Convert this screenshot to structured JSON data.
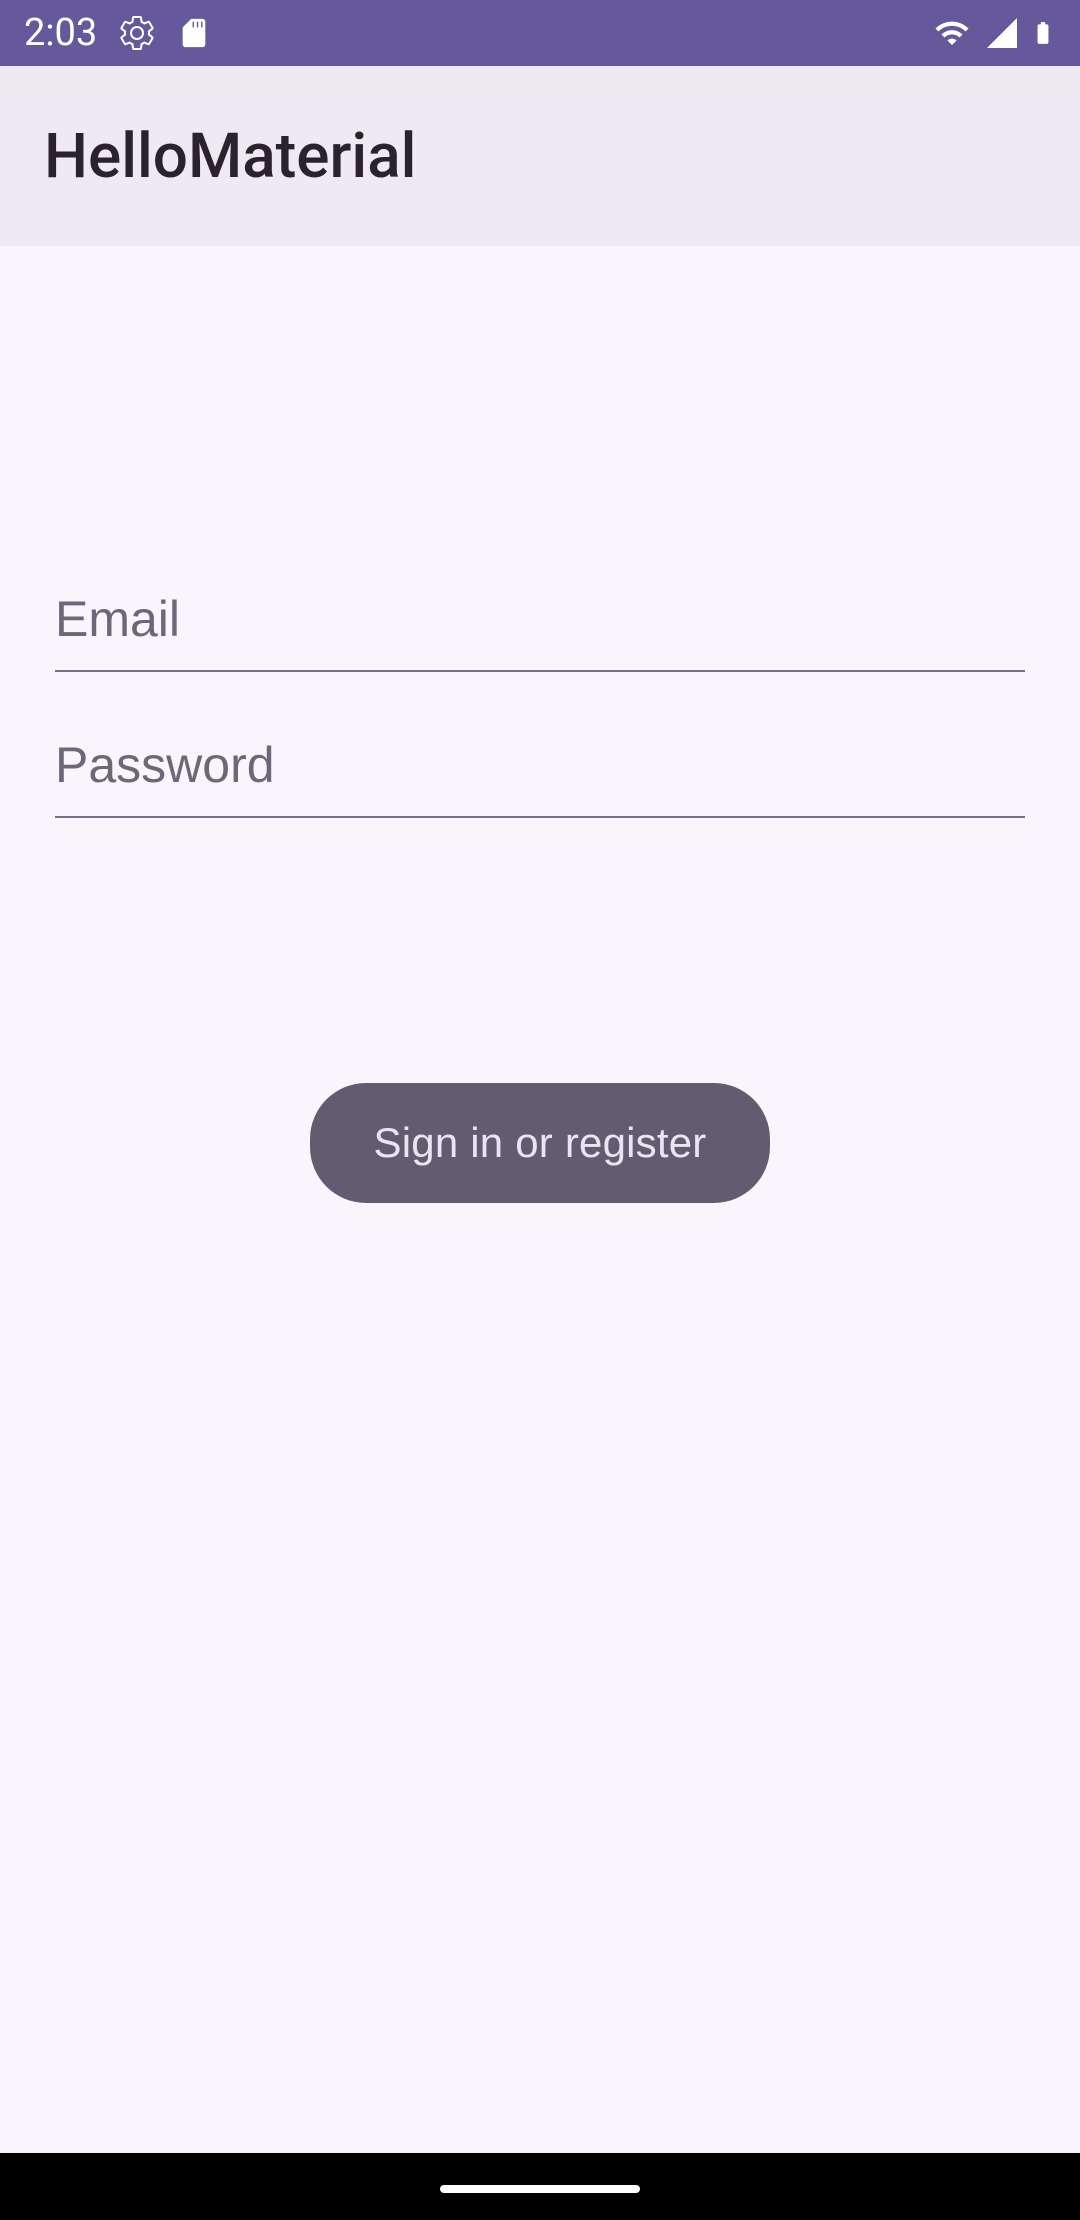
{
  "status": {
    "time": "2:03"
  },
  "appbar": {
    "title": "HelloMaterial"
  },
  "form": {
    "email_placeholder": "Email",
    "email_value": "",
    "password_placeholder": "Password",
    "password_value": ""
  },
  "button": {
    "signin_label": "Sign in or register"
  },
  "colors": {
    "status_bar": "#65589b",
    "app_bar": "#efe9f4",
    "content_bg": "#faf5fd",
    "button_bg": "#635b70",
    "button_text": "#ece4f2",
    "underline": "#7a7085"
  }
}
